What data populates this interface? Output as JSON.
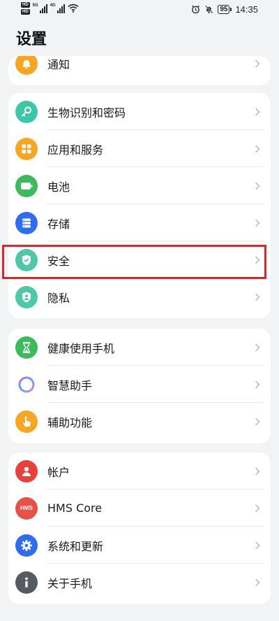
{
  "status_bar": {
    "hd1": "HD",
    "hd2": "HD",
    "sig1_label": "5G",
    "sig2_label": "4G",
    "battery": "95",
    "time": "14:35"
  },
  "page_title": "设置",
  "groups": [
    {
      "items": [
        {
          "label": "通知",
          "icon": "bell-icon",
          "color": "#f5a623"
        }
      ]
    },
    {
      "items": [
        {
          "label": "生物识别和密码",
          "icon": "key-icon",
          "color": "#3cc7a8"
        },
        {
          "label": "应用和服务",
          "icon": "apps-grid-icon",
          "color": "#f5a623"
        },
        {
          "label": "电池",
          "icon": "battery-icon",
          "color": "#3dbb5c"
        },
        {
          "label": "存储",
          "icon": "storage-icon",
          "color": "#2f6cf0"
        },
        {
          "label": "安全",
          "icon": "shield-icon",
          "color": "#4fc8aa"
        },
        {
          "label": "隐私",
          "icon": "privacy-icon",
          "color": "#4fc8aa"
        }
      ]
    },
    {
      "items": [
        {
          "label": "健康使用手机",
          "icon": "hourglass-icon",
          "color": "#3dbb5c"
        },
        {
          "label": "智慧助手",
          "icon": "assistant-ring-icon",
          "color": "#ffffff"
        },
        {
          "label": "辅助功能",
          "icon": "hand-pointer-icon",
          "color": "#f5a623"
        }
      ]
    },
    {
      "items": [
        {
          "label": "帐户",
          "icon": "account-icon",
          "color": "#e8403a"
        },
        {
          "label": "HMS Core",
          "icon": "hms-icon",
          "color": "#e8504a",
          "icon_text": "HMS"
        },
        {
          "label": "系统和更新",
          "icon": "gear-icon",
          "color": "#2f6cf0"
        },
        {
          "label": "关于手机",
          "icon": "info-icon",
          "color": "#555b61"
        }
      ]
    }
  ]
}
